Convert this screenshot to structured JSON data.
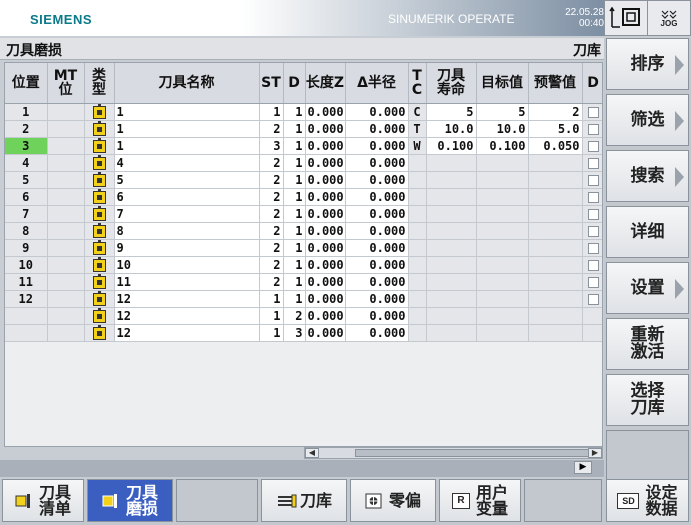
{
  "header": {
    "brand": "SIEMENS",
    "product": "SINUMERIK OPERATE",
    "date": "22.05.28",
    "time": "00:40",
    "mode": "JOG"
  },
  "title": {
    "left": "刀具磨损",
    "right": "刀库"
  },
  "columns": [
    "位置",
    "MT\n位",
    "类\n型",
    "刀具名称",
    "ST",
    "D",
    "长度Z",
    "Δ半径",
    "T\nC",
    "刀具\n寿命",
    "目标值",
    "预警值",
    "D"
  ],
  "rows": [
    {
      "pos": "1",
      "name": "1",
      "st": "1",
      "d": "1",
      "len": "0.000",
      "rad": "0.000",
      "tc": "C",
      "life": "5",
      "target": "5",
      "warn": "2",
      "chk": true
    },
    {
      "pos": "2",
      "name": "1",
      "st": "2",
      "d": "1",
      "len": "0.000",
      "rad": "0.000",
      "tc": "T",
      "life": "10.0",
      "target": "10.0",
      "warn": "5.0",
      "chk": true
    },
    {
      "pos": "3",
      "name": "1",
      "st": "3",
      "d": "1",
      "len": "0.000",
      "rad": "0.000",
      "tc": "W",
      "life": "0.100",
      "target": "0.100",
      "warn": "0.050",
      "chk": true,
      "selected": true
    },
    {
      "pos": "4",
      "name": "4",
      "st": "2",
      "d": "1",
      "len": "0.000",
      "rad": "0.000",
      "tc": "",
      "life": "",
      "target": "",
      "warn": "",
      "chk": true
    },
    {
      "pos": "5",
      "name": "5",
      "st": "2",
      "d": "1",
      "len": "0.000",
      "rad": "0.000",
      "tc": "",
      "life": "",
      "target": "",
      "warn": "",
      "chk": true
    },
    {
      "pos": "6",
      "name": "6",
      "st": "2",
      "d": "1",
      "len": "0.000",
      "rad": "0.000",
      "tc": "",
      "life": "",
      "target": "",
      "warn": "",
      "chk": true
    },
    {
      "pos": "7",
      "name": "7",
      "st": "2",
      "d": "1",
      "len": "0.000",
      "rad": "0.000",
      "tc": "",
      "life": "",
      "target": "",
      "warn": "",
      "chk": true
    },
    {
      "pos": "8",
      "name": "8",
      "st": "2",
      "d": "1",
      "len": "0.000",
      "rad": "0.000",
      "tc": "",
      "life": "",
      "target": "",
      "warn": "",
      "chk": true
    },
    {
      "pos": "9",
      "name": "9",
      "st": "2",
      "d": "1",
      "len": "0.000",
      "rad": "0.000",
      "tc": "",
      "life": "",
      "target": "",
      "warn": "",
      "chk": true
    },
    {
      "pos": "10",
      "name": "10",
      "st": "2",
      "d": "1",
      "len": "0.000",
      "rad": "0.000",
      "tc": "",
      "life": "",
      "target": "",
      "warn": "",
      "chk": true
    },
    {
      "pos": "11",
      "name": "11",
      "st": "2",
      "d": "1",
      "len": "0.000",
      "rad": "0.000",
      "tc": "",
      "life": "",
      "target": "",
      "warn": "",
      "chk": true
    },
    {
      "pos": "12",
      "name": "12",
      "st": "1",
      "d": "1",
      "len": "0.000",
      "rad": "0.000",
      "tc": "",
      "life": "",
      "target": "",
      "warn": "",
      "chk": true
    },
    {
      "pos": "",
      "name": "12",
      "st": "1",
      "d": "2",
      "len": "0.000",
      "rad": "0.000",
      "tc": "",
      "life": "",
      "target": "",
      "warn": "",
      "chk": false
    },
    {
      "pos": "",
      "name": "12",
      "st": "1",
      "d": "3",
      "len": "0.000",
      "rad": "0.000",
      "tc": "",
      "life": "",
      "target": "",
      "warn": "",
      "chk": false
    }
  ],
  "vsoftkeys": [
    "排序",
    "筛选",
    "搜索",
    "详细",
    "设置",
    "重新\n激活",
    "选择\n刀库",
    ""
  ],
  "hsoftkeys": {
    "k1": "刀具\n清单",
    "k2": "刀具\n磨损",
    "k3": "",
    "k4": "刀库",
    "k5": "零偏",
    "k6": "用户\n变量",
    "k7": "",
    "k8": "设定\n数据"
  },
  "icons": {
    "mode": "jog-icon",
    "sd": "SD",
    "r": "R"
  },
  "colors": {
    "selected_row": "#6fd25a",
    "selected_softkey": "#3b5fc0"
  }
}
